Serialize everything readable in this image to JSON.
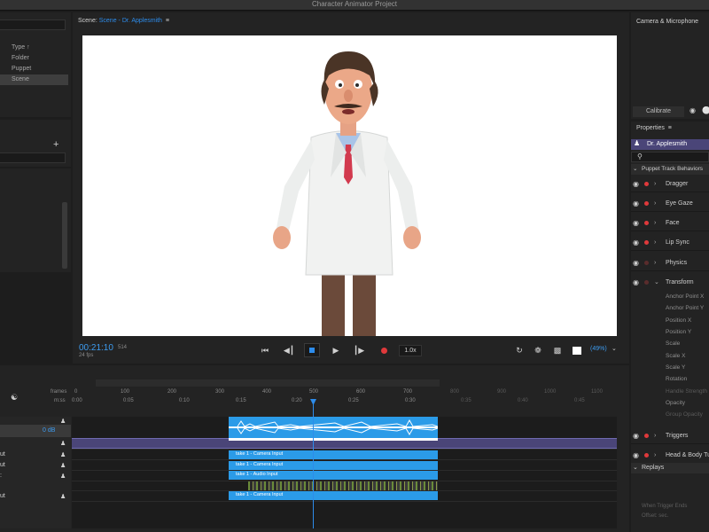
{
  "app": {
    "title": "Character Animator Project"
  },
  "project_panel": {
    "items": [
      {
        "label": "Type",
        "sort_indicator": "↑",
        "selected": false
      },
      {
        "label": "Folder",
        "selected": false
      },
      {
        "label": "Puppet",
        "selected": false
      },
      {
        "label": "Scene",
        "selected": true
      }
    ],
    "add_icon": "+"
  },
  "scene": {
    "prefix": "Scene:",
    "name": "Scene - Dr. Applesmith",
    "menu_icon": "≡",
    "timecode": "00:21:10",
    "frame": "514",
    "fps": "24 fps",
    "speed": "1.0x",
    "zoom": "(49%)"
  },
  "camera_panel": {
    "title": "Camera & Microphone",
    "calibrate_label": "Calibrate"
  },
  "properties": {
    "title": "Properties",
    "menu_icon": "≡",
    "puppet_name": "Dr. Applesmith",
    "section": "Puppet Track Behaviors",
    "behaviors": [
      {
        "label": "Dragger",
        "armed": true,
        "expanded": false
      },
      {
        "label": "Eye Gaze",
        "armed": true,
        "expanded": false
      },
      {
        "label": "Face",
        "armed": true,
        "expanded": false
      },
      {
        "label": "Lip Sync",
        "armed": true,
        "expanded": false
      },
      {
        "label": "Physics",
        "armed": false,
        "expanded": false
      },
      {
        "label": "Transform",
        "armed": false,
        "expanded": true
      }
    ],
    "transform_params": [
      {
        "label": "Anchor Point X",
        "enabled": true
      },
      {
        "label": "Anchor Point Y",
        "enabled": true
      },
      {
        "label": "Position X",
        "enabled": true
      },
      {
        "label": "Position Y",
        "enabled": true
      },
      {
        "label": "Scale",
        "enabled": true
      },
      {
        "label": "Scale X",
        "enabled": true
      },
      {
        "label": "Scale Y",
        "enabled": true
      },
      {
        "label": "Rotation",
        "enabled": true
      },
      {
        "label": "Handle Strength",
        "enabled": false
      },
      {
        "label": "Opacity",
        "enabled": true
      },
      {
        "label": "Group Opacity",
        "enabled": false
      }
    ],
    "more_behaviors": [
      {
        "label": "Triggers",
        "armed": true
      },
      {
        "label": "Head & Body Tu",
        "armed": true
      }
    ],
    "replays_label": "Replays",
    "trigger_note": "When Trigger Ends",
    "offset_note": "Offset:          sec."
  },
  "timeline": {
    "frames_label": "frames",
    "mss_label": "m:ss",
    "frame_ticks": [
      "0",
      "100",
      "200",
      "300",
      "400",
      "500",
      "600",
      "700",
      "800",
      "900",
      "1000",
      "1100"
    ],
    "time_ticks": [
      "0:00",
      "0:05",
      "0:10",
      "0:15",
      "0:20",
      "0:25",
      "0:30",
      "0:35",
      "0:40",
      "0:45"
    ],
    "db_value": "0 dB",
    "track_labels": [
      "ut",
      "ut",
      ":",
      "ut"
    ],
    "take_labels": [
      "take 1 - Camera Input",
      "take 1 - Camera Input",
      "take 1 - Audio Input",
      "take 1 - Camera Input"
    ]
  },
  "colors": {
    "accent": "#2d8ceb",
    "take_bar": "#2b9be8",
    "record": "#e0393b",
    "puppet_row": "#4a4578"
  }
}
